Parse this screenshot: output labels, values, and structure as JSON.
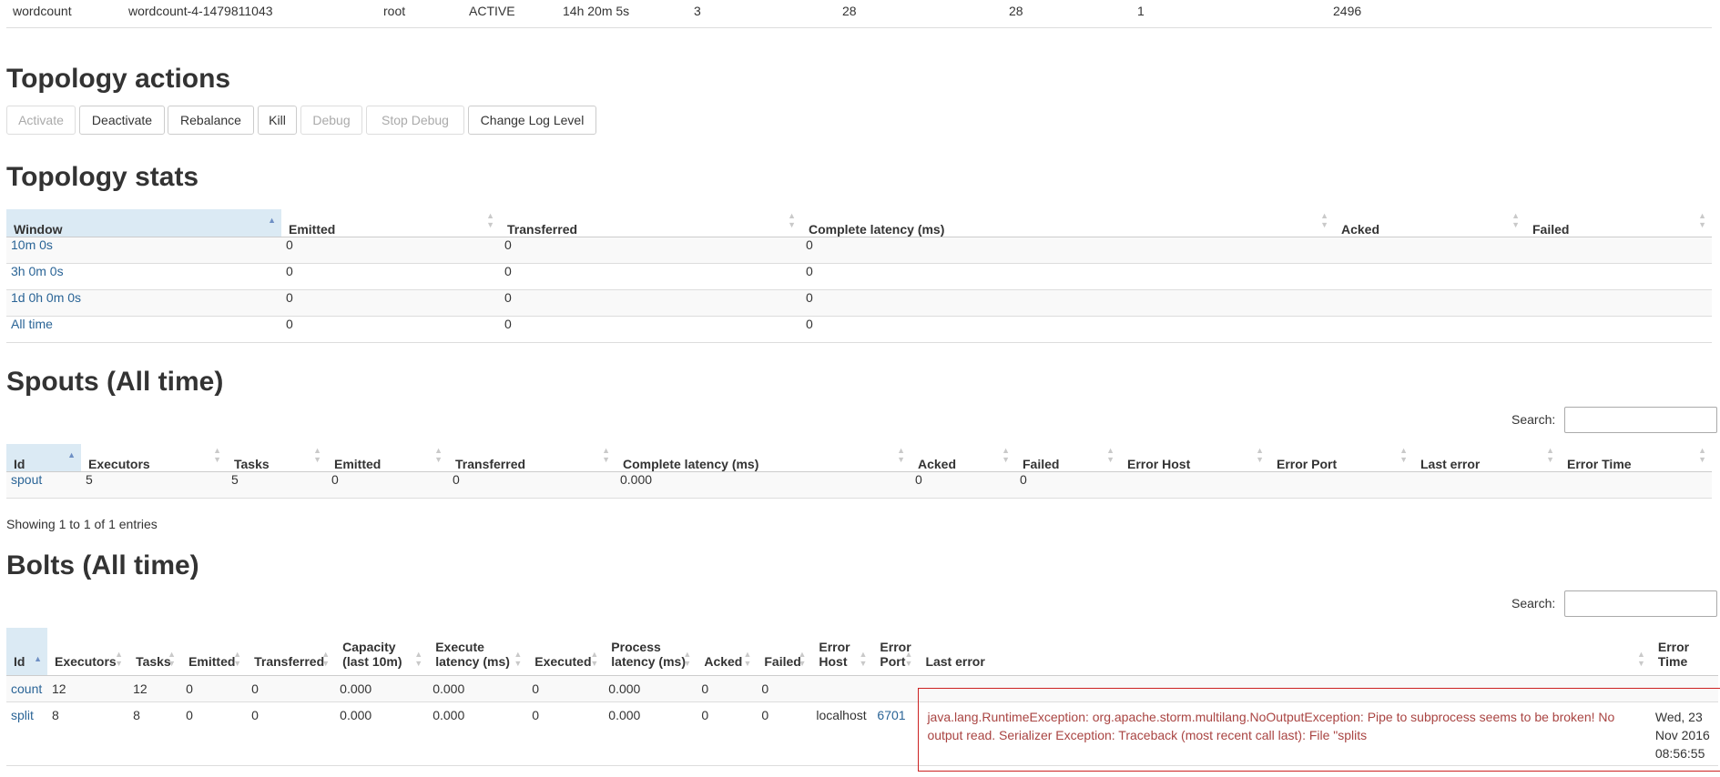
{
  "summary": {
    "name": "wordcount",
    "id": "wordcount-4-1479811043",
    "owner": "root",
    "status": "ACTIVE",
    "uptime": "14h 20m 5s",
    "workers": "3",
    "executors": "28",
    "tasks": "28",
    "replication": "1",
    "memory": "2496"
  },
  "actions": {
    "heading": "Topology actions",
    "buttons": [
      {
        "label": "Activate",
        "enabled": false
      },
      {
        "label": "Deactivate",
        "enabled": true
      },
      {
        "label": "Rebalance",
        "enabled": true
      },
      {
        "label": "Kill",
        "enabled": true
      },
      {
        "label": "Debug",
        "enabled": false
      },
      {
        "label": "Stop Debug",
        "enabled": false
      },
      {
        "label": "Change Log Level",
        "enabled": true
      }
    ]
  },
  "stats": {
    "heading": "Topology stats",
    "columns": [
      "Window",
      "Emitted",
      "Transferred",
      "Complete latency (ms)",
      "Acked",
      "Failed"
    ],
    "rows": [
      {
        "window": "10m 0s",
        "emitted": "0",
        "transferred": "0",
        "latency": "0",
        "acked": "",
        "failed": ""
      },
      {
        "window": "3h 0m 0s",
        "emitted": "0",
        "transferred": "0",
        "latency": "0",
        "acked": "",
        "failed": ""
      },
      {
        "window": "1d 0h 0m 0s",
        "emitted": "0",
        "transferred": "0",
        "latency": "0",
        "acked": "",
        "failed": ""
      },
      {
        "window": "All time",
        "emitted": "0",
        "transferred": "0",
        "latency": "0",
        "acked": "",
        "failed": ""
      }
    ]
  },
  "spouts": {
    "heading": "Spouts (All time)",
    "search_label": "Search:",
    "columns": [
      "Id",
      "Executors",
      "Tasks",
      "Emitted",
      "Transferred",
      "Complete latency (ms)",
      "Acked",
      "Failed",
      "Error Host",
      "Error Port",
      "Last error",
      "Error Time"
    ],
    "rows": [
      {
        "id": "spout",
        "executors": "5",
        "tasks": "5",
        "emitted": "0",
        "transferred": "0",
        "latency": "0.000",
        "acked": "0",
        "failed": "0",
        "error_host": "",
        "error_port": "",
        "last_error": "",
        "error_time": ""
      }
    ],
    "info": "Showing 1 to 1 of 1 entries"
  },
  "bolts": {
    "heading": "Bolts (All time)",
    "search_label": "Search:",
    "columns": {
      "id": "Id",
      "executors": "Executors",
      "tasks": "Tasks",
      "emitted": "Emitted",
      "transferred": "Transferred",
      "capacity_1": "Capacity",
      "capacity_2": "(last 10m)",
      "exec_lat_1": "Execute",
      "exec_lat_2": "latency (ms)",
      "executed": "Executed",
      "proc_lat_1": "Process",
      "proc_lat_2": "latency (ms)",
      "acked": "Acked",
      "failed": "Failed",
      "error_host_1": "Error",
      "error_host_2": "Host",
      "error_port_1": "Error",
      "error_port_2": "Port",
      "last_error": "Last error",
      "error_time": "Error Time"
    },
    "rows": [
      {
        "id": "count",
        "executors": "12",
        "tasks": "12",
        "emitted": "0",
        "transferred": "0",
        "capacity": "0.000",
        "exec_latency": "0.000",
        "executed": "0",
        "proc_latency": "0.000",
        "acked": "0",
        "failed": "0",
        "error_host": "",
        "error_port": "",
        "last_error": "",
        "error_time": ""
      },
      {
        "id": "split",
        "executors": "8",
        "tasks": "8",
        "emitted": "0",
        "transferred": "0",
        "capacity": "0.000",
        "exec_latency": "0.000",
        "executed": "0",
        "proc_latency": "0.000",
        "acked": "0",
        "failed": "0",
        "error_host": "localhost",
        "error_port": "6701",
        "last_error": "java.lang.RuntimeException: org.apache.storm.multilang.NoOutputException: Pipe to subprocess seems to be broken! No output read. Serializer Exception: Traceback (most recent call last): File \"splits",
        "error_time_1": "Wed, 23",
        "error_time_2": "Nov 2016",
        "error_time_3": "08:56:55"
      }
    ]
  }
}
